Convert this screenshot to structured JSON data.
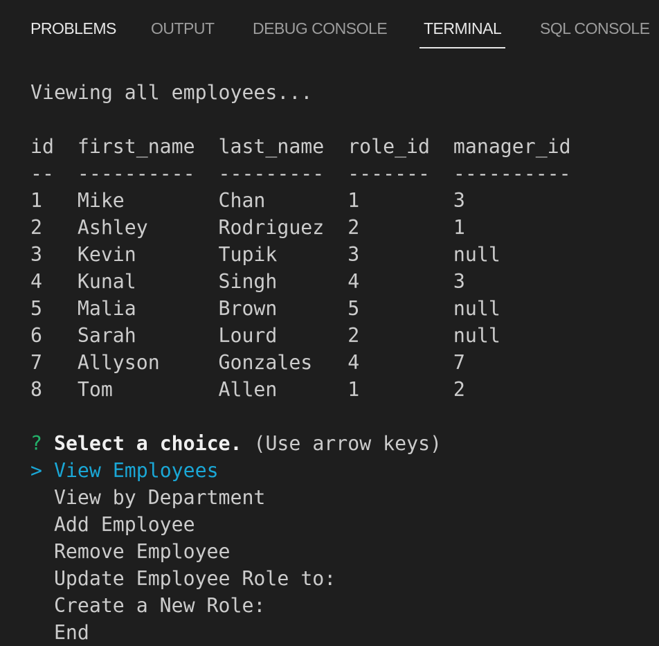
{
  "tabs": [
    {
      "label": "PROBLEMS"
    },
    {
      "label": "OUTPUT"
    },
    {
      "label": "DEBUG CONSOLE"
    },
    {
      "label": "TERMINAL",
      "active": true
    },
    {
      "label": "SQL CONSOLE"
    }
  ],
  "terminal": {
    "status": "Viewing all employees...",
    "columns": [
      "id",
      "first_name",
      "last_name",
      "role_id",
      "manager_id"
    ],
    "dashes": [
      "--",
      "----------",
      "---------",
      "-------",
      "----------"
    ],
    "rows": [
      [
        "1",
        "Mike",
        "Chan",
        "1",
        "3"
      ],
      [
        "2",
        "Ashley",
        "Rodriguez",
        "2",
        "1"
      ],
      [
        "3",
        "Kevin",
        "Tupik",
        "3",
        "null"
      ],
      [
        "4",
        "Kunal",
        "Singh",
        "4",
        "3"
      ],
      [
        "5",
        "Malia",
        "Brown",
        "5",
        "null"
      ],
      [
        "6",
        "Sarah",
        "Lourd",
        "2",
        "null"
      ],
      [
        "7",
        "Allyson",
        "Gonzales",
        "4",
        "7"
      ],
      [
        "8",
        "Tom",
        "Allen",
        "1",
        "2"
      ]
    ],
    "prompt": {
      "mark": "?",
      "question": "Select a choice.",
      "hint": "(Use arrow keys)"
    },
    "pointer": ">",
    "options": [
      "View Employees",
      "View by Department",
      "Add Employee",
      "Remove Employee",
      "Update Employee Role to:",
      "Create a New Role:",
      "End"
    ]
  },
  "colors": {
    "background": "#1e1e1e",
    "text": "#cccccc",
    "selected": "#1aa7d6",
    "prompt_mark": "#23b26a"
  }
}
